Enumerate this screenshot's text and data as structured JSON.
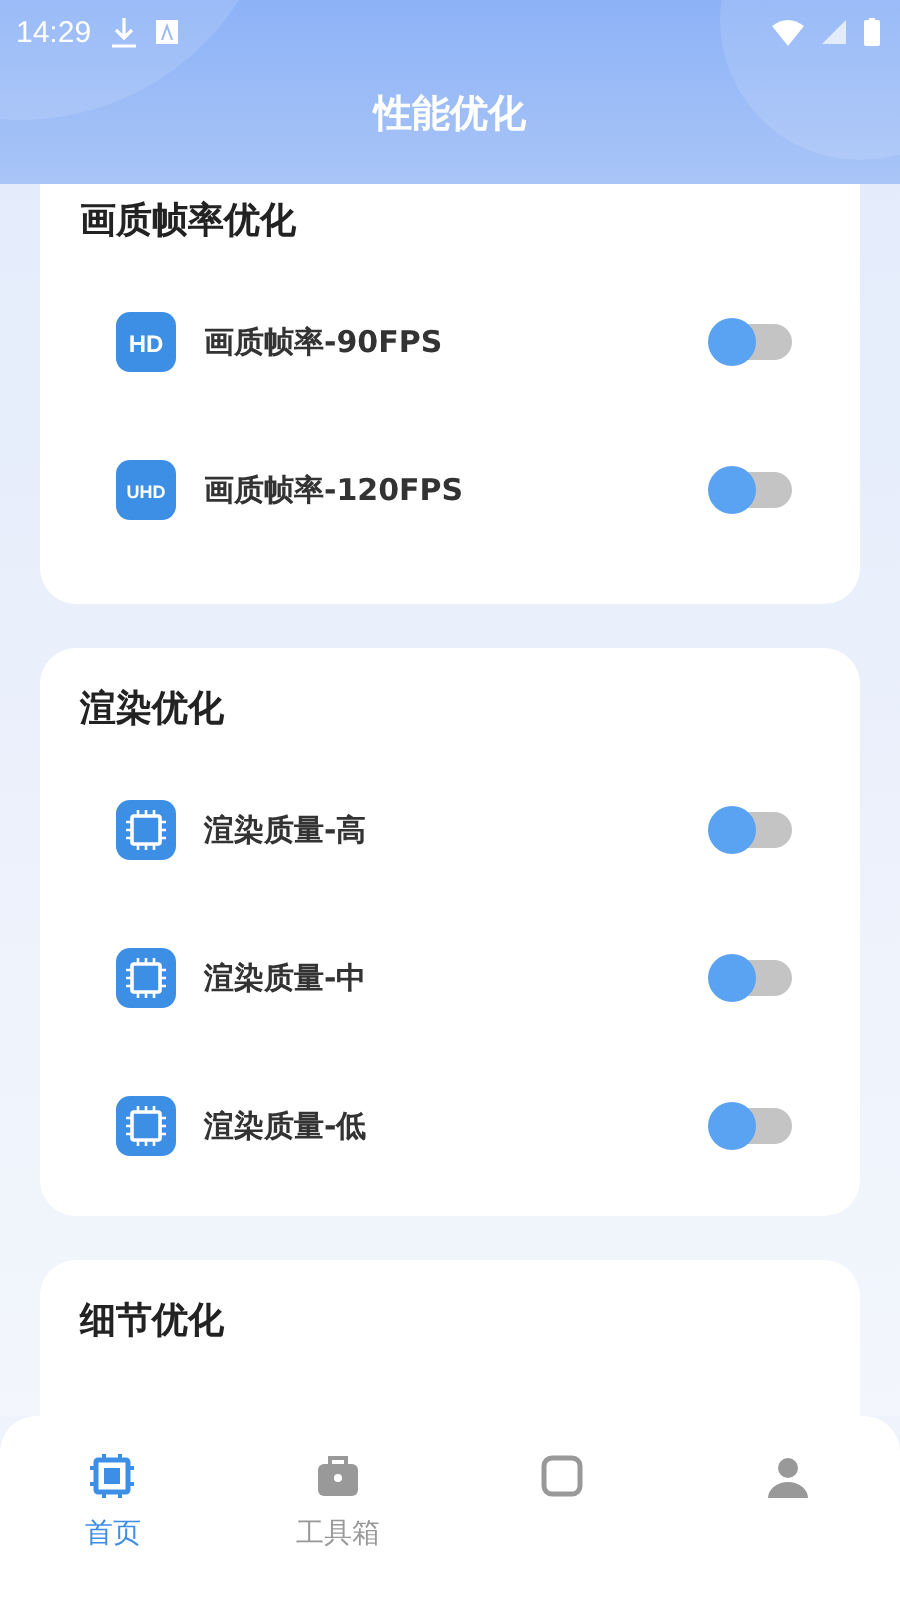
{
  "status_bar": {
    "time": "14:29"
  },
  "title": "性能优化",
  "sections": [
    {
      "title": "画质帧率优化",
      "items": [
        {
          "kind": "hd",
          "badge": "HD",
          "label": "画质帧率-90FPS",
          "on": false
        },
        {
          "kind": "uhd",
          "badge": "UHD",
          "label": "画质帧率-120FPS",
          "on": false
        }
      ]
    },
    {
      "title": "渲染优化",
      "items": [
        {
          "kind": "chip",
          "label": "渲染质量-高",
          "on": false
        },
        {
          "kind": "chip",
          "label": "渲染质量-中",
          "on": false
        },
        {
          "kind": "chip",
          "label": "渲染质量-低",
          "on": false
        }
      ]
    },
    {
      "title": "细节优化"
    }
  ],
  "tabs": [
    {
      "kind": "home",
      "label": "首页",
      "selected": true
    },
    {
      "kind": "toolbox",
      "label": "工具箱",
      "selected": false
    },
    {
      "kind": "tab3",
      "selected": false
    },
    {
      "kind": "tab4",
      "selected": false
    }
  ]
}
